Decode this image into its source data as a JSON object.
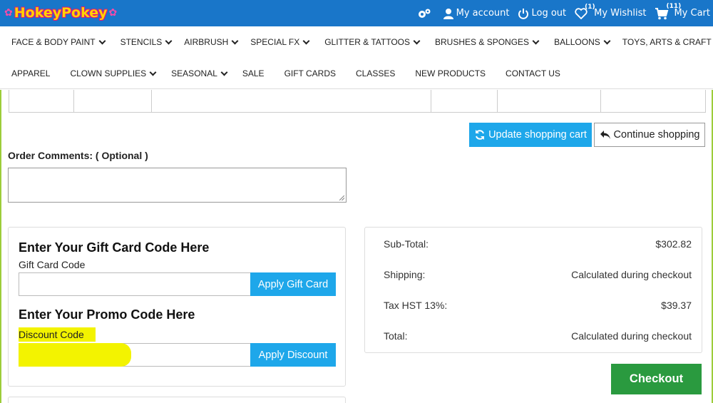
{
  "header": {
    "logo_text": "HokeyPokey",
    "links": {
      "account": "My account",
      "logout": "Log out",
      "wishlist": "My Wishlist",
      "wishlist_count": "(1)",
      "cart": "My Cart",
      "cart_count": "(11)"
    },
    "icons": [
      "gears-icon",
      "user-icon",
      "power-icon",
      "heart-icon",
      "cart-icon"
    ]
  },
  "nav": {
    "row1": [
      {
        "label": "FACE & BODY PAINT",
        "dropdown": true
      },
      {
        "label": "STENCILS",
        "dropdown": true
      },
      {
        "label": "AIRBRUSH",
        "dropdown": true
      },
      {
        "label": "SPECIAL FX",
        "dropdown": true
      },
      {
        "label": "GLITTER & TATTOOS",
        "dropdown": true
      },
      {
        "label": "BRUSHES & SPONGES",
        "dropdown": true
      },
      {
        "label": "BALLOONS",
        "dropdown": true
      },
      {
        "label": "TOYS, ARTS & CRAFT",
        "dropdown": true
      }
    ],
    "row2": [
      {
        "label": "APPAREL",
        "dropdown": false
      },
      {
        "label": "CLOWN SUPPLIES",
        "dropdown": true
      },
      {
        "label": "SEASONAL",
        "dropdown": true
      },
      {
        "label": "SALE",
        "dropdown": false
      },
      {
        "label": "GIFT CARDS",
        "dropdown": false
      },
      {
        "label": "CLASSES",
        "dropdown": false
      },
      {
        "label": "NEW PRODUCTS",
        "dropdown": false
      },
      {
        "label": "CONTACT US",
        "dropdown": false
      }
    ]
  },
  "cart_actions": {
    "update_label": "Update shopping cart",
    "continue_label": "Continue shopping"
  },
  "order_comments": {
    "label": "Order Comments: ( Optional )",
    "value": ""
  },
  "gift_card": {
    "heading": "Enter Your Gift Card Code Here",
    "field_label": "Gift Card Code",
    "value": "",
    "button_label": "Apply Gift Card"
  },
  "promo": {
    "heading": "Enter Your Promo Code Here",
    "field_label": "Discount Code",
    "value": "",
    "button_label": "Apply Discount"
  },
  "totals": [
    {
      "label": "Sub-Total:",
      "value": "$302.82"
    },
    {
      "label": "Shipping:",
      "value": "Calculated during checkout"
    },
    {
      "label": "Tax HST 13%:",
      "value": "$39.37"
    },
    {
      "label": "Total:",
      "value": "Calculated during checkout"
    }
  ],
  "checkout": {
    "label": "Checkout"
  },
  "colors": {
    "topbar": "#1976c9",
    "accent_button": "#1ea7ea",
    "checkout_button": "#2a9a3f",
    "page_border": "#9ccd3a",
    "highlight": "#f3f300"
  }
}
